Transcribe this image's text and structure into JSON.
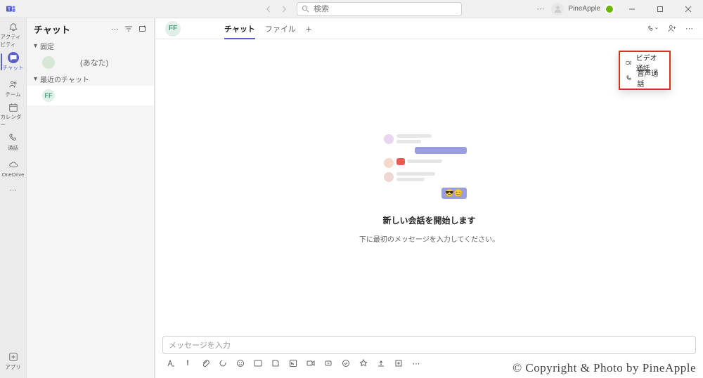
{
  "titlebar": {
    "search_placeholder": "検索",
    "user_name": "PineApple"
  },
  "rail": {
    "items": [
      {
        "label": "アクティビティ"
      },
      {
        "label": "チャット"
      },
      {
        "label": "チーム"
      },
      {
        "label": "カレンダー"
      },
      {
        "label": "通話"
      },
      {
        "label": "OneDrive"
      }
    ],
    "apps_label": "アプリ"
  },
  "sidebar": {
    "title": "チャット",
    "sections": {
      "pinned": "固定",
      "recent": "最近のチャット"
    },
    "items": [
      {
        "name": "(あなた)",
        "initials": ""
      },
      {
        "name": "",
        "initials": "FF"
      }
    ]
  },
  "chat_header": {
    "avatar_initials": "FF",
    "tabs": [
      {
        "label": "チャット",
        "active": true
      },
      {
        "label": "ファイル",
        "active": false
      }
    ]
  },
  "empty_state": {
    "title": "新しい会話を開始します",
    "subtitle": "下に最初のメッセージを入力してください。"
  },
  "composer": {
    "placeholder": "メッセージを入力"
  },
  "dropdown": {
    "items": [
      {
        "label": "ビデオ通話"
      },
      {
        "label": "音声通話"
      }
    ]
  },
  "watermark": "© Copyright & Photo by PineApple"
}
